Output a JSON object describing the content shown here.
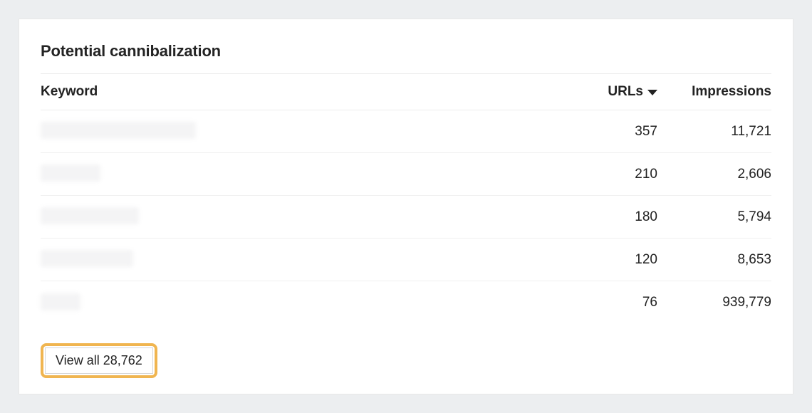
{
  "panel": {
    "title": "Potential cannibalization"
  },
  "table": {
    "headers": {
      "keyword": "Keyword",
      "urls": "URLs",
      "impressions": "Impressions"
    },
    "rows": [
      {
        "keyword_redacted_width": 218,
        "urls": "357",
        "impressions": "11,721"
      },
      {
        "keyword_redacted_width": 84,
        "urls": "210",
        "impressions": "2,606"
      },
      {
        "keyword_redacted_width": 138,
        "urls": "180",
        "impressions": "5,794"
      },
      {
        "keyword_redacted_width": 130,
        "urls": "120",
        "impressions": "8,653"
      },
      {
        "keyword_redacted_width": 56,
        "urls": "76",
        "impressions": "939,779"
      }
    ]
  },
  "footer": {
    "view_all_label": "View all 28,762"
  }
}
